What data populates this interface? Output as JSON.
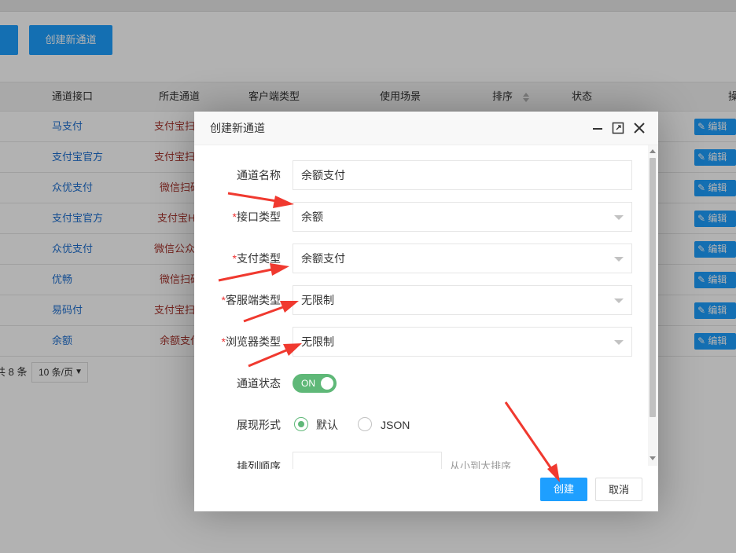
{
  "toolbar": {
    "left_button_label": "",
    "create_channel_button": "创建新通道"
  },
  "table": {
    "columns": [
      "通道接口",
      "所走通道",
      "客户端类型",
      "使用场景",
      "排序",
      "状态",
      "操"
    ],
    "rows": [
      {
        "interface": "马支付",
        "channel": "支付宝扫",
        "edit": "编辑"
      },
      {
        "interface": "支付宝官方",
        "channel": "支付宝扫",
        "edit": "编辑"
      },
      {
        "interface": "众优支付",
        "channel": "微信扫码",
        "edit": "编辑"
      },
      {
        "interface": "支付宝官方",
        "channel": "支付宝H",
        "edit": "编辑"
      },
      {
        "interface": "众优支付",
        "channel": "微信公众",
        "edit": "编辑"
      },
      {
        "interface": "优畅",
        "channel": "微信扫码",
        "edit": "编辑"
      },
      {
        "interface": "易码付",
        "channel": "支付宝扫",
        "edit": "编辑"
      },
      {
        "interface": "余额",
        "channel": "余额支付",
        "edit": "编辑"
      }
    ]
  },
  "pager": {
    "total_text": "共 8 条",
    "page_size": "10 条/页"
  },
  "dialog": {
    "title": "创建新通道",
    "fields": {
      "channel_name": {
        "label": "通道名称",
        "value": "余额支付"
      },
      "interface_type": {
        "label": "接口类型",
        "value": "余额"
      },
      "pay_type": {
        "label": "支付类型",
        "value": "余额支付"
      },
      "client_type": {
        "label": "客服端类型",
        "value": "无限制"
      },
      "browser_type": {
        "label": "浏览器类型",
        "value": "无限制"
      },
      "status": {
        "label": "通道状态",
        "value": "ON"
      },
      "display_form": {
        "label": "展现形式",
        "option_default": "默认",
        "option_json": "JSON",
        "selected": "默认"
      },
      "sort_order": {
        "label": "排列顺序",
        "value": "",
        "hint": "从小到大排序"
      }
    },
    "create_button": "创建",
    "cancel_button": "取消"
  },
  "colors": {
    "primary": "#1e9fff",
    "switch_on": "#5fb878",
    "link": "#1e6fd0",
    "required": "#e33",
    "annotation_arrow": "#f0392f"
  },
  "icons": [
    "minimize-icon",
    "maximize-icon",
    "close-icon",
    "edit-icon",
    "sort-icon",
    "dropdown-caret-icon",
    "annotation-arrow"
  ]
}
